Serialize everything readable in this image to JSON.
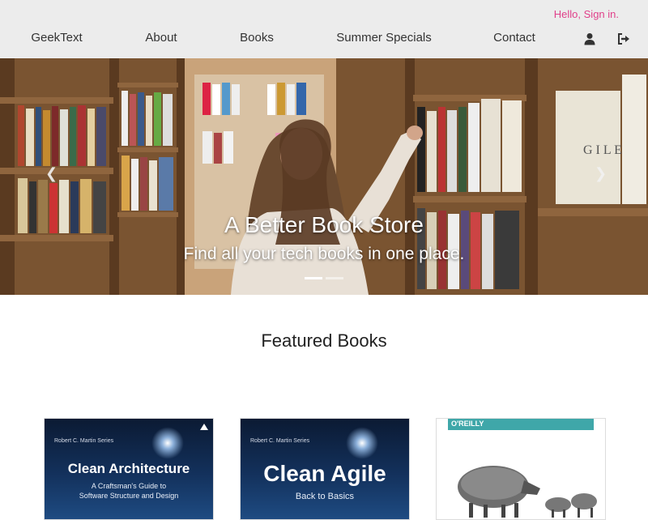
{
  "header": {
    "greeting": "Hello, Sign in.",
    "nav": [
      {
        "label": "GeekText"
      },
      {
        "label": "About"
      },
      {
        "label": "Books"
      },
      {
        "label": "Summer Specials"
      },
      {
        "label": "Contact"
      }
    ],
    "icons": {
      "account": "user-icon",
      "logout": "sign-out-icon"
    }
  },
  "hero": {
    "title": "A Better Book Store",
    "subtitle": "Find all your tech books in one place.",
    "slides": 2,
    "active_slide": 1,
    "image": "woman browsing bookshelves"
  },
  "featured": {
    "heading": "Featured Books",
    "books": [
      {
        "series": "Robert C. Martin Series",
        "title": "Clean Architecture",
        "subtitle_line1": "A Craftsman's Guide to",
        "subtitle_line2": "Software Structure and Design"
      },
      {
        "series": "Robert C. Martin Series",
        "title": "Clean Agile",
        "subtitle_line1": "Back to Basics",
        "subtitle_line2": ""
      },
      {
        "publisher": "O'REILLY",
        "cover_art": "wild boar with piglets"
      }
    ]
  },
  "colors": {
    "header_bg": "#ececec",
    "greeting": "#e0408a",
    "oreilly_teal": "#3fa7a9"
  }
}
